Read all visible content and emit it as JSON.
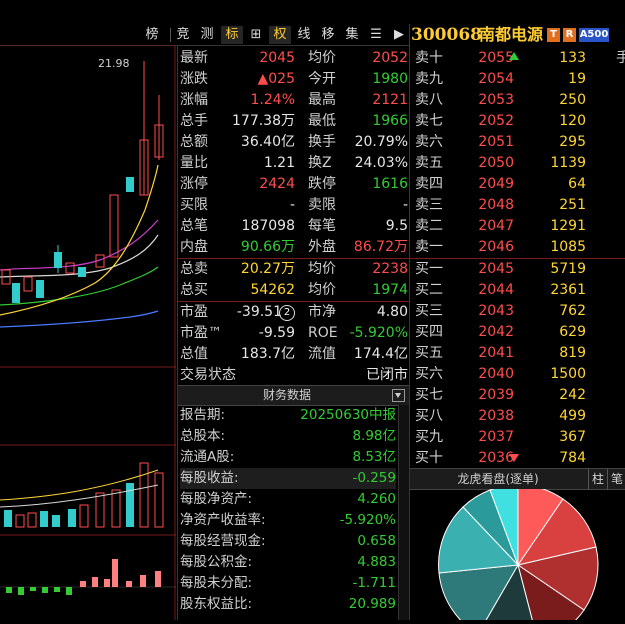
{
  "toolbar": {
    "items": [
      "榜",
      "竞",
      "测",
      "标",
      "⊞",
      "权",
      "线",
      "移",
      "集",
      "☰",
      "▶"
    ],
    "active_index": 3
  },
  "stock": {
    "code": "300068",
    "name": "南都电源",
    "badge_t": "T",
    "badge_r": "R",
    "badge_index": "A500",
    "edge_text": "手"
  },
  "chart": {
    "high_label": "21.98"
  },
  "quote": [
    {
      "l1": "最新",
      "v1": "2045",
      "c1": "red",
      "l2": "均价",
      "v2": "2052",
      "c2": "red"
    },
    {
      "l1": "涨跌",
      "v1": "▲025",
      "c1": "red",
      "l2": "今开",
      "v2": "1980",
      "c2": "green"
    },
    {
      "l1": "涨幅",
      "v1": "1.24%",
      "c1": "red",
      "l2": "最高",
      "v2": "2121",
      "c2": "red"
    },
    {
      "l1": "总手",
      "v1": "177.38万",
      "c1": "white",
      "l2": "最低",
      "v2": "1966",
      "c2": "green"
    },
    {
      "l1": "总额",
      "v1": "36.40亿",
      "c1": "white",
      "l2": "换手",
      "v2": "20.79%",
      "c2": "white"
    },
    {
      "l1": "量比",
      "v1": "1.21",
      "c1": "white",
      "l2": "换Z",
      "v2": "24.03%",
      "c2": "white"
    },
    {
      "l1": "涨停",
      "v1": "2424",
      "c1": "red",
      "l2": "跌停",
      "v2": "1616",
      "c2": "green"
    },
    {
      "l1": "买限",
      "v1": "-",
      "c1": "white",
      "l2": "卖限",
      "v2": "-",
      "c2": "white"
    },
    {
      "l1": "总笔",
      "v1": "187098",
      "c1": "white",
      "l2": "每笔",
      "v2": "9.5",
      "c2": "white"
    },
    {
      "l1": "内盘",
      "v1": "90.66万",
      "c1": "green",
      "l2": "外盘",
      "v2": "86.72万",
      "c2": "red"
    },
    {
      "l1": "总卖",
      "v1": "20.27万",
      "c1": "yellow",
      "l2": "均价",
      "v2": "2238",
      "c2": "red"
    },
    {
      "l1": "总买",
      "v1": "54262",
      "c1": "yellow",
      "l2": "均价",
      "v2": "1974",
      "c2": "green"
    },
    {
      "l1": "市盈",
      "v1": "-39.51",
      "c1": "white",
      "l2": "市净",
      "v2": "4.80",
      "c2": "white"
    },
    {
      "l1": "市盈™",
      "v1": "-9.59",
      "c1": "white",
      "l2": "ROE",
      "v2": "-5.920%",
      "c2": "green"
    },
    {
      "l1": "总值",
      "v1": "183.7亿",
      "c1": "white",
      "l2": "流值",
      "v2": "174.4亿",
      "c2": "white"
    },
    {
      "l1": "交易状态",
      "v1": "",
      "c1": "white",
      "l2": "",
      "v2": "已闭市",
      "c2": "white"
    }
  ],
  "pe_badge": "2",
  "book": {
    "sell": [
      {
        "label": "卖十",
        "price": "2055",
        "vol": "133"
      },
      {
        "label": "卖九",
        "price": "2054",
        "vol": "19"
      },
      {
        "label": "卖八",
        "price": "2053",
        "vol": "250"
      },
      {
        "label": "卖七",
        "price": "2052",
        "vol": "120"
      },
      {
        "label": "卖六",
        "price": "2051",
        "vol": "295"
      },
      {
        "label": "卖五",
        "price": "2050",
        "vol": "1139"
      },
      {
        "label": "卖四",
        "price": "2049",
        "vol": "64"
      },
      {
        "label": "卖三",
        "price": "2048",
        "vol": "251"
      },
      {
        "label": "卖二",
        "price": "2047",
        "vol": "1291"
      },
      {
        "label": "卖一",
        "price": "2046",
        "vol": "1085"
      }
    ],
    "buy": [
      {
        "label": "买一",
        "price": "2045",
        "vol": "5719"
      },
      {
        "label": "买二",
        "price": "2044",
        "vol": "2361"
      },
      {
        "label": "买三",
        "price": "2043",
        "vol": "762"
      },
      {
        "label": "买四",
        "price": "2042",
        "vol": "629"
      },
      {
        "label": "买五",
        "price": "2041",
        "vol": "819"
      },
      {
        "label": "买六",
        "price": "2040",
        "vol": "1500"
      },
      {
        "label": "买七",
        "price": "2039",
        "vol": "242"
      },
      {
        "label": "买八",
        "price": "2038",
        "vol": "499"
      },
      {
        "label": "买九",
        "price": "2037",
        "vol": "367"
      },
      {
        "label": "买十",
        "price": "2036",
        "vol": "784"
      }
    ]
  },
  "finance": {
    "title": "财务数据",
    "rows": [
      {
        "label": "报告期:",
        "value": "20250630中报"
      },
      {
        "label": "总股本:",
        "value": "8.98亿"
      },
      {
        "label": "流通A股:",
        "value": "8.53亿"
      },
      {
        "label": "每股收益:",
        "value": "-0.259"
      },
      {
        "label": "每股净资产:",
        "value": "4.260"
      },
      {
        "label": "净资产收益率:",
        "value": "-5.920%"
      },
      {
        "label": "每股经营现金:",
        "value": "0.658"
      },
      {
        "label": "每股公积金:",
        "value": "4.883"
      },
      {
        "label": "每股未分配:",
        "value": "-1.711"
      },
      {
        "label": "股东权益比:",
        "value": "20.989"
      }
    ]
  },
  "dragon_tiger": {
    "title": "龙虎看盘(逐单)",
    "tab1": "柱",
    "tab2": "笔"
  },
  "colors": {
    "red": "#ff4d4d",
    "green": "#33cc33",
    "yellow": "#ffd633",
    "accent": "#ffcc33"
  }
}
